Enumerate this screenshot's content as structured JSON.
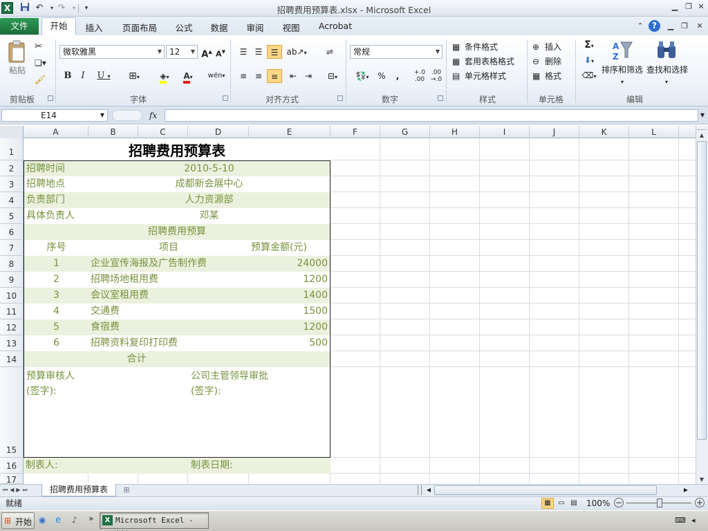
{
  "window": {
    "title": "招聘费用预算表.xlsx - Microsoft Excel"
  },
  "tabs": [
    "文件",
    "开始",
    "插入",
    "页面布局",
    "公式",
    "数据",
    "审阅",
    "视图",
    "Acrobat"
  ],
  "ribbon": {
    "paste_label": "粘贴",
    "font_name": "微软雅黑",
    "font_size": "12",
    "number_format": "常规",
    "percent": "%",
    "comma": ",",
    "dec_inc": "+.0 .00",
    "dec_dec": ".00 →.0",
    "cond_format": "条件格式",
    "table_format": "套用表格格式",
    "cell_styles": "单元格样式",
    "insert": "插入",
    "delete": "删除",
    "format": "格式",
    "sort_filter": "排序和筛选",
    "find_select": "查找和选择",
    "groups": [
      "剪贴板",
      "字体",
      "对齐方式",
      "数字",
      "样式",
      "单元格",
      "编辑"
    ]
  },
  "formula_bar": {
    "name_box": "E14",
    "fx": "fx",
    "value": ""
  },
  "columns": [
    "A",
    "B",
    "C",
    "D",
    "E",
    "F",
    "G",
    "H",
    "I",
    "J",
    "K",
    "L"
  ],
  "rows": [
    "1",
    "2",
    "3",
    "4",
    "5",
    "6",
    "7",
    "8",
    "9",
    "10",
    "11",
    "12",
    "13",
    "14",
    "15",
    "16",
    "17"
  ],
  "sheet": {
    "title": "招聘费用预算表",
    "time_label": "招聘时间",
    "time_value": "2010-5-10",
    "place_label": "招聘地点",
    "place_value": "成都新会展中心",
    "dept_label": "负责部门",
    "dept_value": "人力资源部",
    "owner_label": "具体负责人",
    "owner_value": "邓某",
    "section": "招聘费用预算",
    "hdr_no": "序号",
    "hdr_item": "项目",
    "hdr_amount": "预算金额(元)",
    "items": [
      {
        "no": "1",
        "name": "企业宣传海报及广告制作费",
        "amount": "24000"
      },
      {
        "no": "2",
        "name": "招聘场地租用费",
        "amount": "1200"
      },
      {
        "no": "3",
        "name": "会议室租用费",
        "amount": "1400"
      },
      {
        "no": "4",
        "name": "交通费",
        "amount": "1500"
      },
      {
        "no": "5",
        "name": "食宿费",
        "amount": "1200"
      },
      {
        "no": "6",
        "name": "招聘资料复印打印费",
        "amount": "500"
      }
    ],
    "total": "合计",
    "reviewer": "预算审核人",
    "reviewer_sign": "(签字):",
    "approver": "公司主管领导审批",
    "approver_sign": "(签字):",
    "maker": "制表人:",
    "make_date": "制表日期:"
  },
  "sheet_tab": "招聘费用预算表",
  "status": {
    "ready": "就绪",
    "zoom": "100%"
  },
  "taskbar": {
    "start": "开始",
    "excel": "Microsoft Excel - ..."
  },
  "colors": {
    "accent_green": "#76923c",
    "fill_green": "#ebf1de",
    "excel_green": "#1e7145"
  }
}
